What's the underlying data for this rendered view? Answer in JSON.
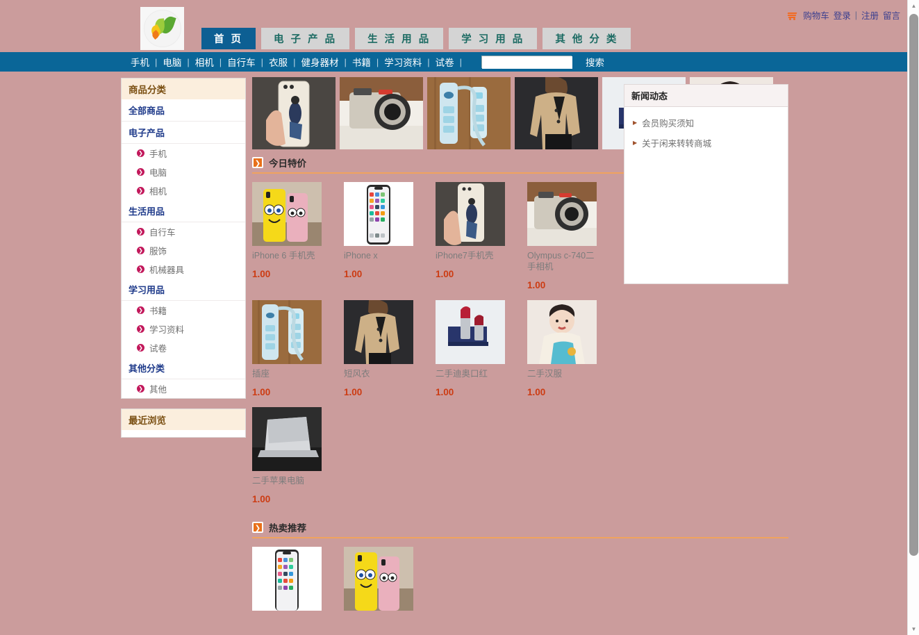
{
  "header": {
    "cart_icon": "cart-icon",
    "cart_label": "购物车",
    "login_label": "登录",
    "separator": "|",
    "register_label": "注册",
    "message_label": "留言",
    "logo_icon": "leaf-logo-icon"
  },
  "tabs": [
    {
      "label": "首 页",
      "active": true
    },
    {
      "label": "电 子 产 品",
      "active": false
    },
    {
      "label": "生 活 用 品",
      "active": false
    },
    {
      "label": "学 习 用 品",
      "active": false
    },
    {
      "label": "其 他 分 类",
      "active": false
    }
  ],
  "subnav": {
    "items": [
      "手机",
      "电脑",
      "相机",
      "自行车",
      "衣服",
      "健身器材",
      "书籍",
      "学习资料",
      "试卷"
    ],
    "divider": "|",
    "search_value": "",
    "search_placeholder": "",
    "search_button": "搜索"
  },
  "sidebar": {
    "title": "商品分类",
    "all_label": "全部商品",
    "groups": [
      {
        "title": "电子产品",
        "items": [
          "手机",
          "电脑",
          "相机"
        ]
      },
      {
        "title": "生活用品",
        "items": [
          "自行车",
          "服饰",
          "机械器具"
        ]
      },
      {
        "title": "学习用品",
        "items": [
          "书籍",
          "学习资料",
          "试卷"
        ]
      },
      {
        "title": "其他分类",
        "items": [
          "其他"
        ]
      }
    ],
    "recent_title": "最近浏览",
    "arrow_icon": "chevron-right-circle-icon"
  },
  "banner": {
    "images": [
      {
        "name": "phone-case-hand-banner"
      },
      {
        "name": "olympus-camera-banner"
      },
      {
        "name": "power-strip-banner"
      },
      {
        "name": "trench-coat-banner"
      },
      {
        "name": "dior-lipstick-banner"
      },
      {
        "name": "hanfu-girl-banner"
      }
    ]
  },
  "today": {
    "icon": "orange-arrow-icon",
    "title": "今日特价",
    "products": [
      {
        "name": "iPhone 6 手机壳",
        "price": "1.00",
        "image": "spongebob-phone-cases"
      },
      {
        "name": "iPhone x",
        "price": "1.00",
        "image": "iphone-x-white"
      },
      {
        "name": "iPhone7手机壳",
        "price": "1.00",
        "image": "illustration-phone-case"
      },
      {
        "name": "Olympus c-740二手相机",
        "price": "1.00",
        "image": "olympus-camera"
      },
      {
        "name": "插座",
        "price": "1.00",
        "image": "power-strip"
      },
      {
        "name": "短风衣",
        "price": "1.00",
        "image": "trench-coat"
      },
      {
        "name": "二手迪奥口红",
        "price": "1.00",
        "image": "dior-lipstick"
      },
      {
        "name": "二手汉服",
        "price": "1.00",
        "image": "hanfu-girl"
      },
      {
        "name": "二手苹果电脑",
        "price": "1.00",
        "image": "macbook-laptop"
      }
    ]
  },
  "news": {
    "title": "新闻动态",
    "bullet_icon": "triangle-bullet-icon",
    "items": [
      "会员购买须知",
      "关于闲来转转商城"
    ]
  },
  "hot": {
    "icon": "orange-arrow-icon",
    "title": "热卖推荐",
    "products": [
      {
        "name": "",
        "price": "",
        "image": "iphone-x-white"
      },
      {
        "name": "",
        "price": "",
        "image": "spongebob-phone-cases"
      }
    ]
  },
  "scrollbar": {
    "up_arrow": "▲",
    "down_arrow": "▼"
  },
  "colors": {
    "page_bg": "#cb9c9c",
    "nav_blue": "#0a6698",
    "accent_orange": "#f0a35e",
    "price_red": "#cc3b12",
    "panel_head": "#fbeedd"
  }
}
